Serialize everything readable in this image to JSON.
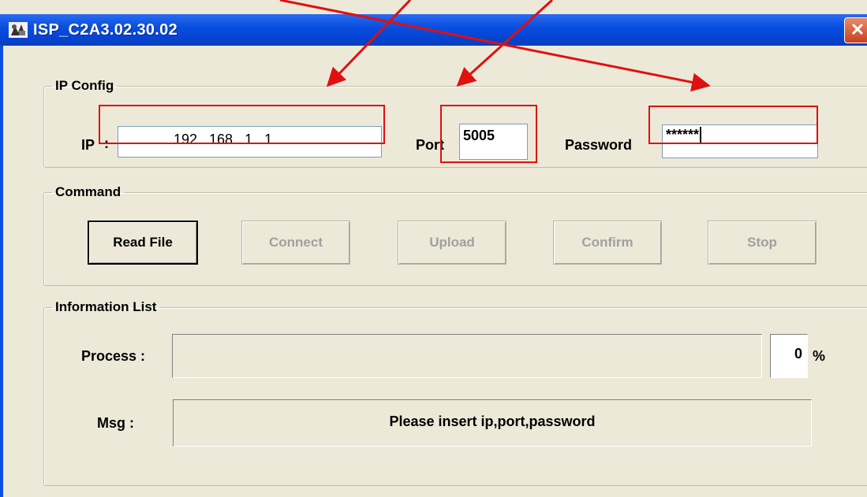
{
  "window": {
    "title": "ISP_C2A3.02.30.02",
    "close_glyph": "✕"
  },
  "ip_config": {
    "legend": "IP Config",
    "ip_label": "IP",
    "ip_colon": ":",
    "ip_value": "192 . 168 . 1 . 1",
    "port_label": "Port",
    "port_value": "5005",
    "password_label": "Password",
    "password_value": "******"
  },
  "command": {
    "legend": "Command",
    "buttons": [
      {
        "label": "Read File",
        "enabled": true
      },
      {
        "label": "Connect",
        "enabled": false
      },
      {
        "label": "Upload",
        "enabled": false
      },
      {
        "label": "Confirm",
        "enabled": false
      },
      {
        "label": "Stop",
        "enabled": false
      }
    ]
  },
  "info": {
    "legend": "Information List",
    "process_label": "Process :",
    "progress_value": "0",
    "progress_unit": "%",
    "msg_label": "Msg :",
    "msg_text": "Please insert ip,port,password"
  },
  "annotations": {
    "color": "#e01010"
  },
  "icons": {
    "app": "app-icon",
    "close": "close-icon"
  }
}
